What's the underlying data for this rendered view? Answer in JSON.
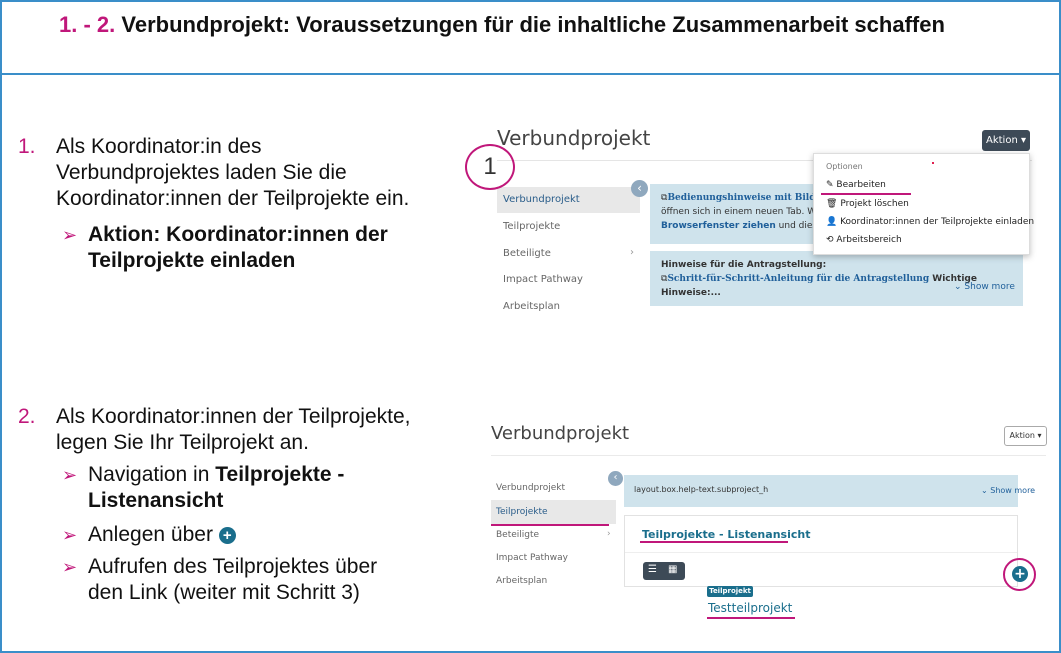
{
  "slide": {
    "title_number": "1. - 2.",
    "title_text": "Verbundprojekt: Voraussetzungen für die inhaltliche Zusammenarbeit schaffen"
  },
  "step1": {
    "number": "1.",
    "text_line1": "Als Koordinator:in des",
    "text_line2": "Verbundprojektes  laden Sie die",
    "text_line3": "Koordinator:innen der Teilprojekte ein.",
    "sub1_line1": "Aktion: Koordinator:innen der",
    "sub1_line2": "Teilprojekte einladen"
  },
  "step2": {
    "number": "2.",
    "text_line1": "Als Koordinator:innen der Teilprojekte,",
    "text_line2": "legen Sie Ihr Teilprojekt an.",
    "sub1_prefix": "Navigation in ",
    "sub1_bold1": "Teilprojekte -",
    "sub1_bold2": "Listenansicht",
    "sub2_text": "Anlegen über",
    "sub2_icon": "+",
    "sub3_line1": "Aufrufen des Teilprojektes über",
    "sub3_line2": "den Link (weiter mit Schritt 3)"
  },
  "shot1": {
    "title": "Verbundprojekt",
    "aktion_label": "Aktion ▾",
    "callout_number": "1",
    "nav": [
      "Verbundprojekt",
      "Teilprojekte",
      "Beteiligte",
      "Impact Pathway",
      "Arbeitsplan"
    ],
    "nav_chevron": "›",
    "collapse_icon": "‹",
    "info1_link": "Bedienungshinweise mit Bild für ein",
    "info1_line2": "öffnen sich in einem neuen Tab. Wen",
    "info1_line3_bold": "Browserfenster ziehen",
    "info1_line3_rest": " und dieses a",
    "info2_title": "Hinweise für die Antragstellung:",
    "info2_link": "Schritt-für-Schritt-Anleitung für die Antragstellung",
    "info2_after": " Wichtige",
    "info2_line3": "Hinweise:...",
    "show_more": "⌄ Show more",
    "dropdown": {
      "header": "Optionen",
      "items": [
        {
          "icon": "✎",
          "label": "Bearbeiten"
        },
        {
          "icon": "🗑",
          "label": "Projekt löschen"
        },
        {
          "icon": "👤",
          "label": "Koordinator:innen der Teilprojekte einladen"
        },
        {
          "icon": "⟲",
          "label": "Arbeitsbereich"
        }
      ]
    }
  },
  "shot2": {
    "title": "Verbundprojekt",
    "aktion_label": "Aktion ▾",
    "nav": [
      "Verbundprojekt",
      "Teilprojekte",
      "Beteiligte",
      "Impact Pathway",
      "Arbeitsplan"
    ],
    "nav_chevron": "›",
    "collapse_icon": "‹",
    "info_text": "layout.box.help-text.subproject_h",
    "show_more": "⌄ Show more",
    "list_heading": "Teilprojekte - Listenansicht",
    "toggle_list_icon": "☰",
    "toggle_grid_icon": "▦",
    "plus_icon": "+",
    "badge": "Teilprojekt",
    "project_link": "Testteilprojekt"
  },
  "colors": {
    "accent_magenta": "#c0177a",
    "border_blue": "#3a8ec9",
    "info_bg": "#cfe3ec",
    "button_dark": "#3d4a57",
    "teal": "#1a6e8c"
  }
}
